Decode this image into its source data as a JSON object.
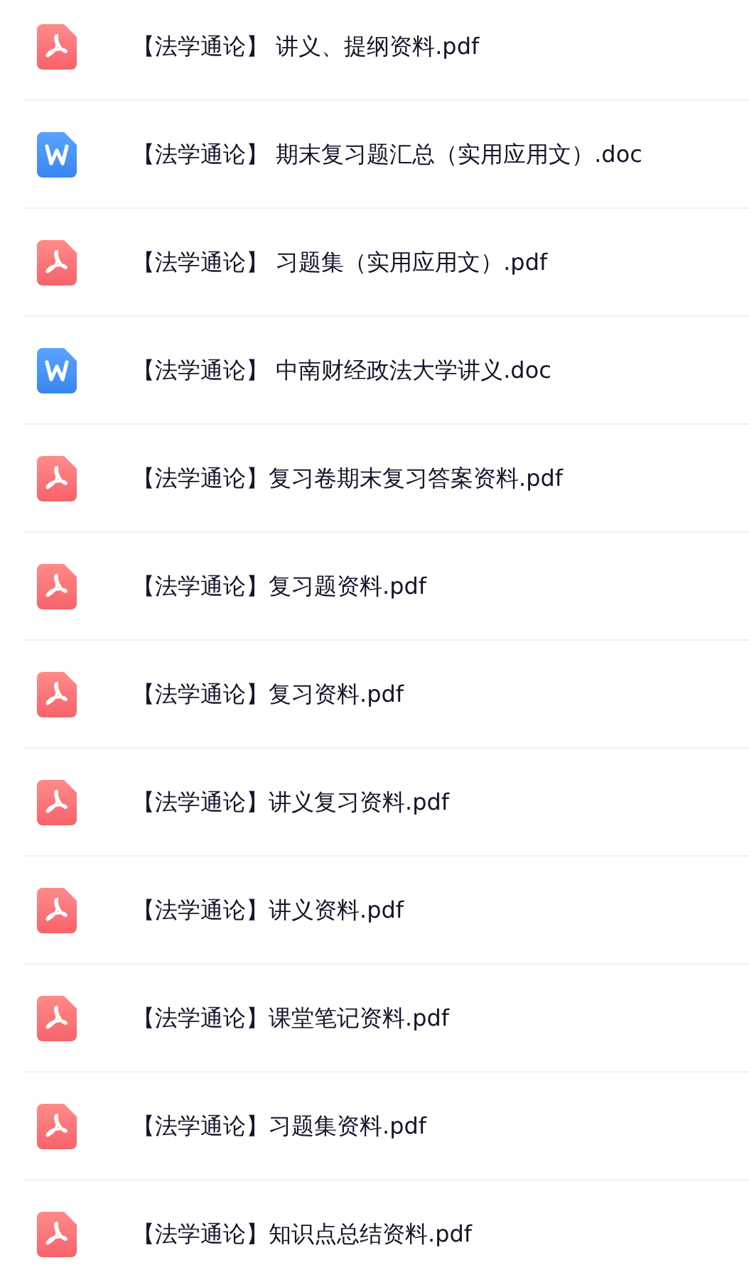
{
  "files": [
    {
      "kind": "pdf",
      "name": "【法学通论】 讲义、提纲资料.pdf"
    },
    {
      "kind": "doc",
      "name": "【法学通论】 期末复习题汇总（实用应用文）.doc"
    },
    {
      "kind": "pdf",
      "name": "【法学通论】 习题集（实用应用文）.pdf"
    },
    {
      "kind": "doc",
      "name": "【法学通论】 中南财经政法大学讲义.doc"
    },
    {
      "kind": "pdf",
      "name": "【法学通论】复习卷期末复习答案资料.pdf"
    },
    {
      "kind": "pdf",
      "name": "【法学通论】复习题资料.pdf"
    },
    {
      "kind": "pdf",
      "name": "【法学通论】复习资料.pdf"
    },
    {
      "kind": "pdf",
      "name": "【法学通论】讲义复习资料.pdf"
    },
    {
      "kind": "pdf",
      "name": "【法学通论】讲义资料.pdf"
    },
    {
      "kind": "pdf",
      "name": "【法学通论】课堂笔记资料.pdf"
    },
    {
      "kind": "pdf",
      "name": "【法学通论】习题集资料.pdf"
    },
    {
      "kind": "pdf",
      "name": "【法学通论】知识点总结资料.pdf"
    }
  ]
}
